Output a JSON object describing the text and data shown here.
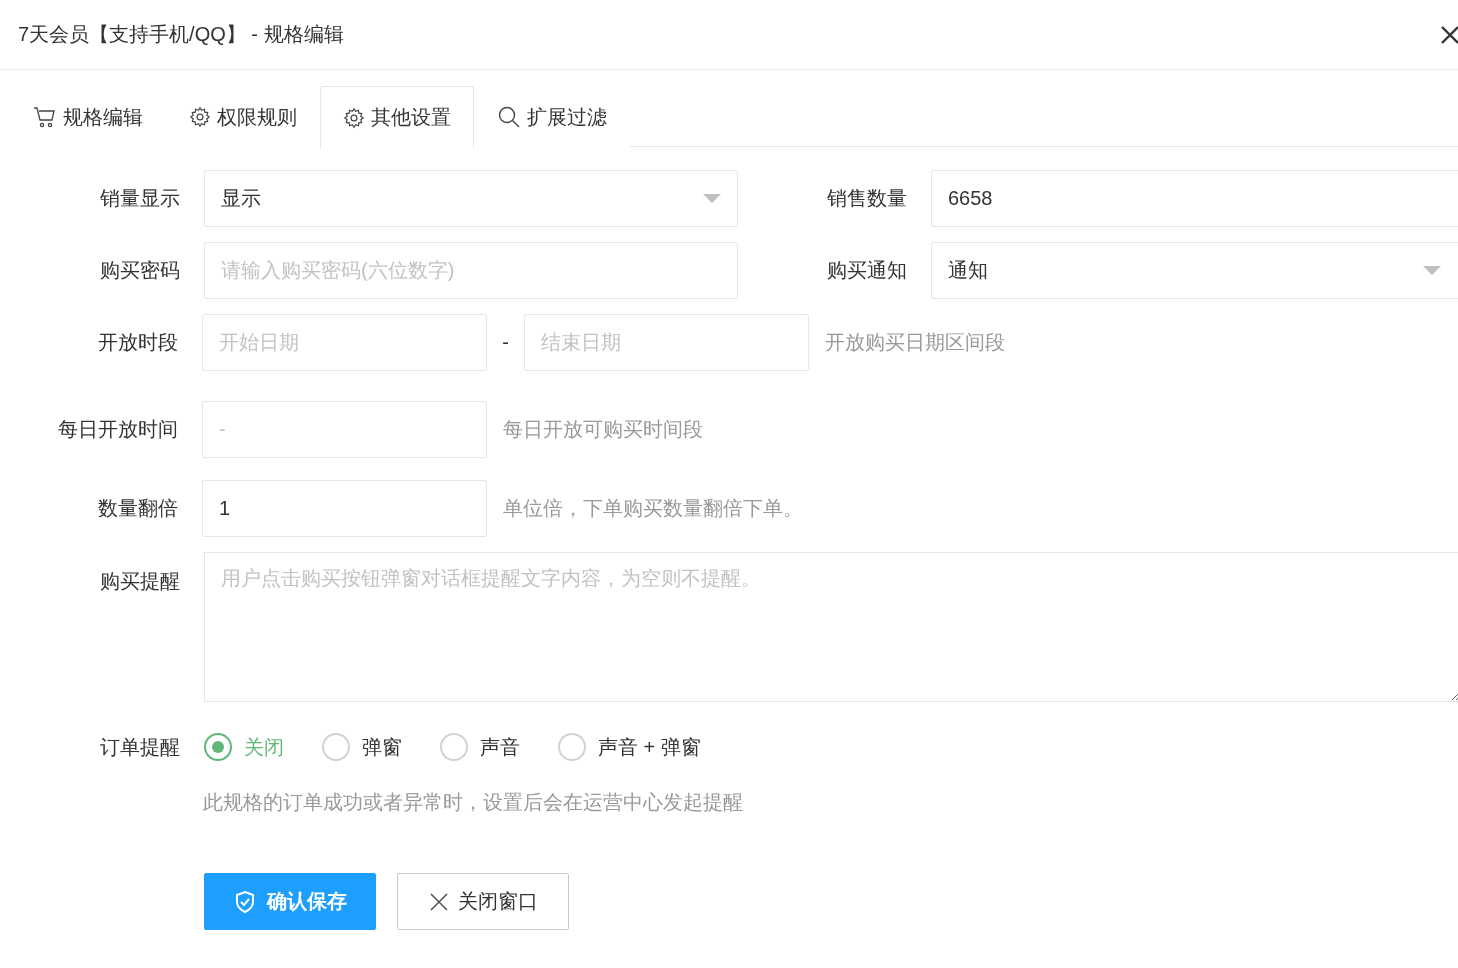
{
  "dialog": {
    "title": "7天会员【支持手机/QQ】 - 规格编辑"
  },
  "tabs": [
    {
      "label": "规格编辑",
      "selected": false
    },
    {
      "label": "权限规则",
      "selected": false
    },
    {
      "label": "其他设置",
      "selected": true
    },
    {
      "label": "扩展过滤",
      "selected": false
    }
  ],
  "sales_display": {
    "label": "销量显示",
    "value": "显示"
  },
  "sales_count": {
    "label": "销售数量",
    "value": "6658"
  },
  "purchase_password": {
    "label": "购买密码",
    "placeholder": "请输入购买密码(六位数字)"
  },
  "purchase_notice": {
    "label": "购买通知",
    "value": "通知"
  },
  "open_period": {
    "label": "开放时段",
    "start_placeholder": "开始日期",
    "separator": "-",
    "end_placeholder": "结束日期",
    "hint": "开放购买日期区间段"
  },
  "daily_open_time": {
    "label": "每日开放时间",
    "placeholder": "-",
    "hint": "每日开放可购买时间段"
  },
  "quantity_multiplier": {
    "label": "数量翻倍",
    "value": "1",
    "hint": "单位倍，下单购买数量翻倍下单。"
  },
  "purchase_reminder": {
    "label": "购买提醒",
    "placeholder": "用户点击购买按钮弹窗对话框提醒文字内容，为空则不提醒。"
  },
  "order_reminder": {
    "label": "订单提醒",
    "options": [
      {
        "label": "关闭",
        "selected": true
      },
      {
        "label": "弹窗",
        "selected": false
      },
      {
        "label": "声音",
        "selected": false
      },
      {
        "label": "声音 + 弹窗",
        "selected": false
      }
    ],
    "hint": "此规格的订单成功或者异常时，设置后会在运营中心发起提醒"
  },
  "buttons": [
    {
      "label": "确认保存",
      "kind": "primary"
    },
    {
      "label": "关闭窗口",
      "kind": "secondary"
    }
  ]
}
